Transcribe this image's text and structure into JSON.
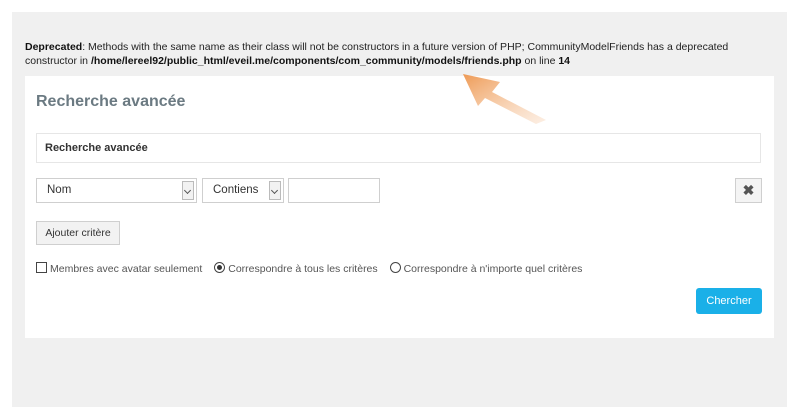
{
  "warning": {
    "label": "Deprecated",
    "text1": ": Methods with the same name as their class will not be constructors in a future version of PHP; CommunityModelFriends has a deprecated constructor in ",
    "path": "/home/lereel92/public_html/eveil.me/components/com_community/models/friends.php",
    "text2": " on line ",
    "line": "14"
  },
  "card": {
    "title": "Recherche avancée",
    "subheader": "Recherche avancée"
  },
  "criteria": {
    "field_select": "Nom",
    "operator_select": "Contiens",
    "value_input": "",
    "remove_icon": "times-icon"
  },
  "add_button": "Ajouter critère",
  "options": {
    "avatar_only": {
      "label": "Membres avec avatar seulement",
      "checked": false
    },
    "match_all": {
      "label": "Correspondre à tous les critères",
      "selected": true
    },
    "match_any": {
      "label": "Correspondre à n'importe quel critères",
      "selected": false
    }
  },
  "search_button": "Chercher",
  "colors": {
    "accent": "#1ab0e8",
    "annotation_arrow": "#f0a86a"
  }
}
